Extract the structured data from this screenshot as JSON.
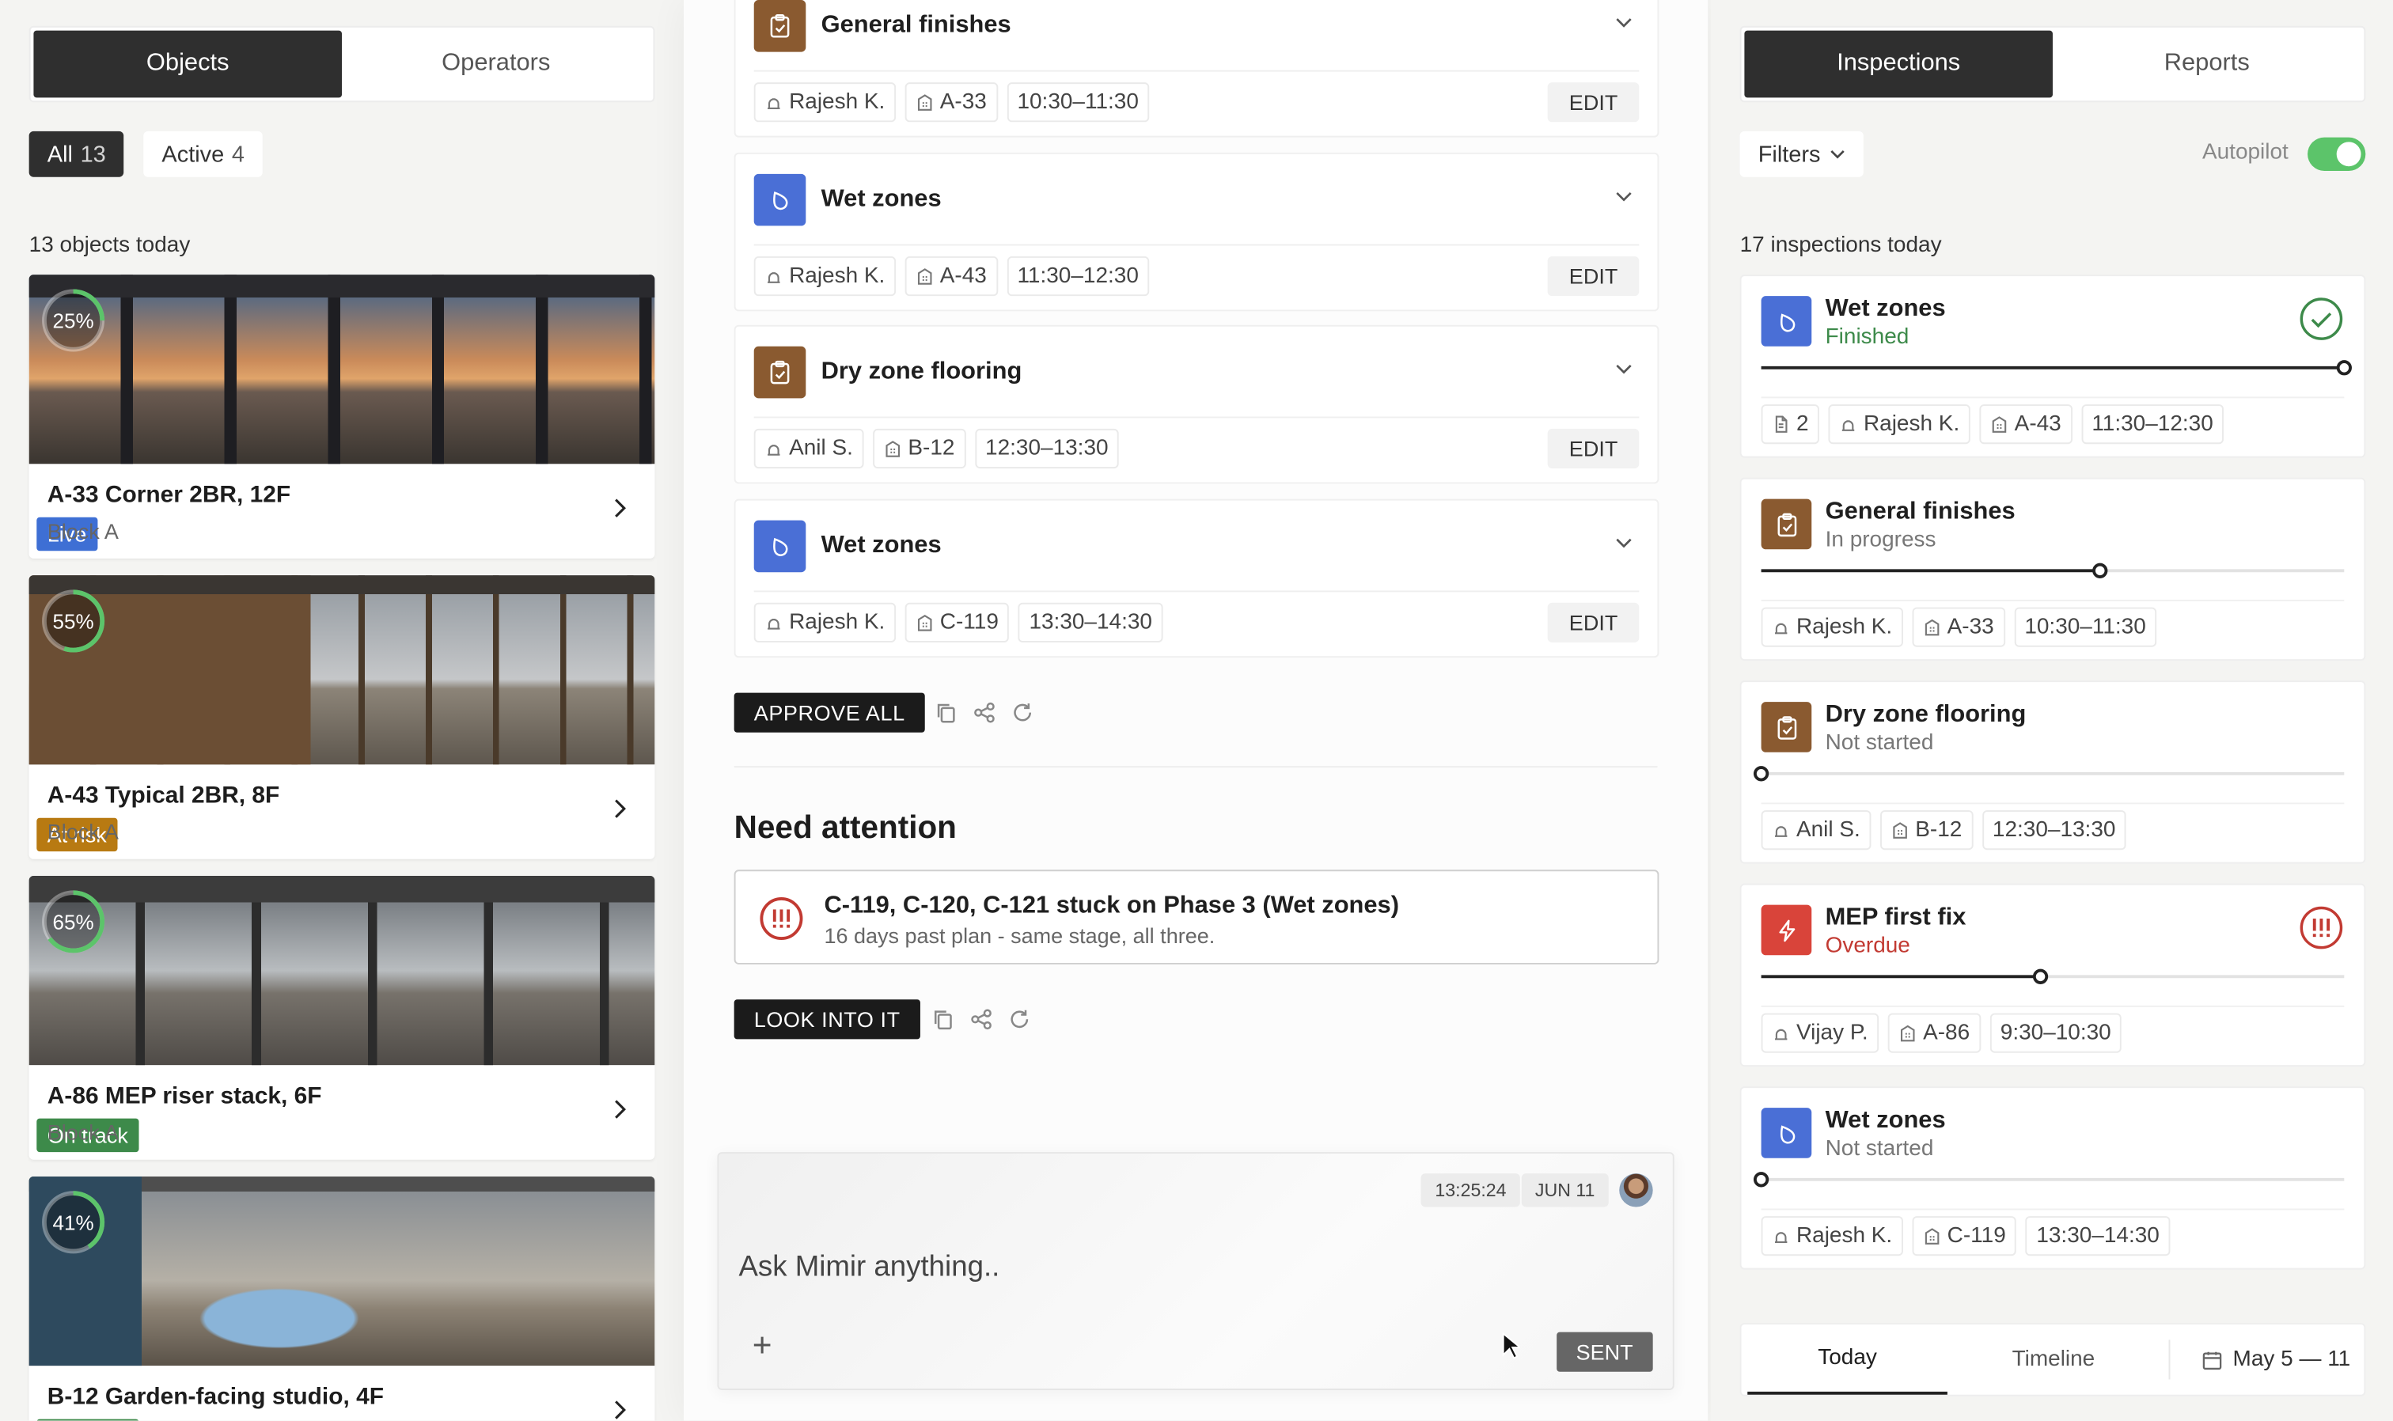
{
  "left": {
    "tabs": [
      "Objects",
      "Operators"
    ],
    "filters": [
      {
        "label": "All",
        "count": "13"
      },
      {
        "label": "Active",
        "count": "4"
      }
    ],
    "section_label": "13 objects today",
    "objects": [
      {
        "pct": "25%",
        "progress": 0.25,
        "badge": "Live",
        "badge_color": "#3e6fd4",
        "title": "A-33 Corner 2BR, 12F",
        "sub": "Block A"
      },
      {
        "pct": "55%",
        "progress": 0.55,
        "badge": "At risk",
        "badge_color": "#b87a12",
        "title": "A-43 Typical 2BR, 8F",
        "sub": "Block A"
      },
      {
        "pct": "65%",
        "progress": 0.65,
        "badge": "On track",
        "badge_color": "#3d8a4a",
        "title": "A-86 MEP riser stack, 6F",
        "sub": "Block A"
      },
      {
        "pct": "41%",
        "progress": 0.41,
        "badge": "On track",
        "badge_color": "#3d8a4a",
        "title": "B-12 Garden-facing studio, 4F",
        "sub": ""
      }
    ]
  },
  "mid": {
    "tasks": [
      {
        "title": "General finishes",
        "icon": "clipboard-icon",
        "color": "#8a5a30",
        "operator": "Rajesh K.",
        "unit": "A-33",
        "time": "10:30–11:30",
        "edit": "EDIT"
      },
      {
        "title": "Wet zones",
        "icon": "droplet-icon",
        "color": "#4a6fd6",
        "operator": "Rajesh K.",
        "unit": "A-43",
        "time": "11:30–12:30",
        "edit": "EDIT"
      },
      {
        "title": "Dry zone flooring",
        "icon": "clipboard-icon",
        "color": "#8a5a30",
        "operator": "Anil S.",
        "unit": "B-12",
        "time": "12:30–13:30",
        "edit": "EDIT"
      },
      {
        "title": "Wet zones",
        "icon": "droplet-icon",
        "color": "#4a6fd6",
        "operator": "Rajesh K.",
        "unit": "C-119",
        "time": "13:30–14:30",
        "edit": "EDIT"
      }
    ],
    "approve_all": "APPROVE ALL",
    "attention_heading": "Need attention",
    "alert": {
      "title": "C-119, C-120, C-121 stuck on Phase 3 (Wet zones)",
      "body": "16 days past plan - same stage, all three.",
      "color": "#c23a32"
    },
    "look_into": "LOOK INTO IT",
    "chat": {
      "time": "13:25:24",
      "date": "JUN 11",
      "placeholder": "Ask Mimir anything..",
      "add": "+",
      "send": "SENT"
    }
  },
  "right": {
    "tabs": [
      "Inspections",
      "Reports"
    ],
    "filters_label": "Filters",
    "autopilot_label": "Autopilot",
    "autopilot_on": true,
    "section_label": "17 inspections today",
    "inspections": [
      {
        "title": "Wet zones",
        "status": "Finished",
        "status_color": "#3d8a4a",
        "icon": "droplet-icon",
        "color": "#4a6fd6",
        "progress": 1.0,
        "docs": "2",
        "operator": "Rajesh K.",
        "unit": "A-43",
        "time": "11:30–12:30",
        "state_icon": "check-circle-icon"
      },
      {
        "title": "General finishes",
        "status": "In progress",
        "status_color": "#777777",
        "icon": "clipboard-icon",
        "color": "#8a5a30",
        "progress": 0.58,
        "docs": "",
        "operator": "Rajesh K.",
        "unit": "A-33",
        "time": "10:30–11:30",
        "state_icon": ""
      },
      {
        "title": "Dry zone flooring",
        "status": "Not started",
        "status_color": "#777777",
        "icon": "clipboard-icon",
        "color": "#8a5a30",
        "progress": 0.0,
        "docs": "",
        "operator": "Anil S.",
        "unit": "B-12",
        "time": "12:30–13:30",
        "state_icon": ""
      },
      {
        "title": "MEP first fix",
        "status": "Overdue",
        "status_color": "#c23a32",
        "icon": "bolt-icon",
        "color": "#d9443a",
        "progress": 0.48,
        "docs": "",
        "operator": "Vijay P.",
        "unit": "A-86",
        "time": "9:30–10:30",
        "state_icon": "alert-circle-icon"
      },
      {
        "title": "Wet zones",
        "status": "Not started",
        "status_color": "#777777",
        "icon": "droplet-icon",
        "color": "#4a6fd6",
        "progress": 0.0,
        "docs": "",
        "operator": "Rajesh K.",
        "unit": "C-119",
        "time": "13:30–14:30",
        "state_icon": ""
      }
    ],
    "bottom_tabs": [
      "Today",
      "Timeline"
    ],
    "date_range": "May 5 — 11"
  }
}
